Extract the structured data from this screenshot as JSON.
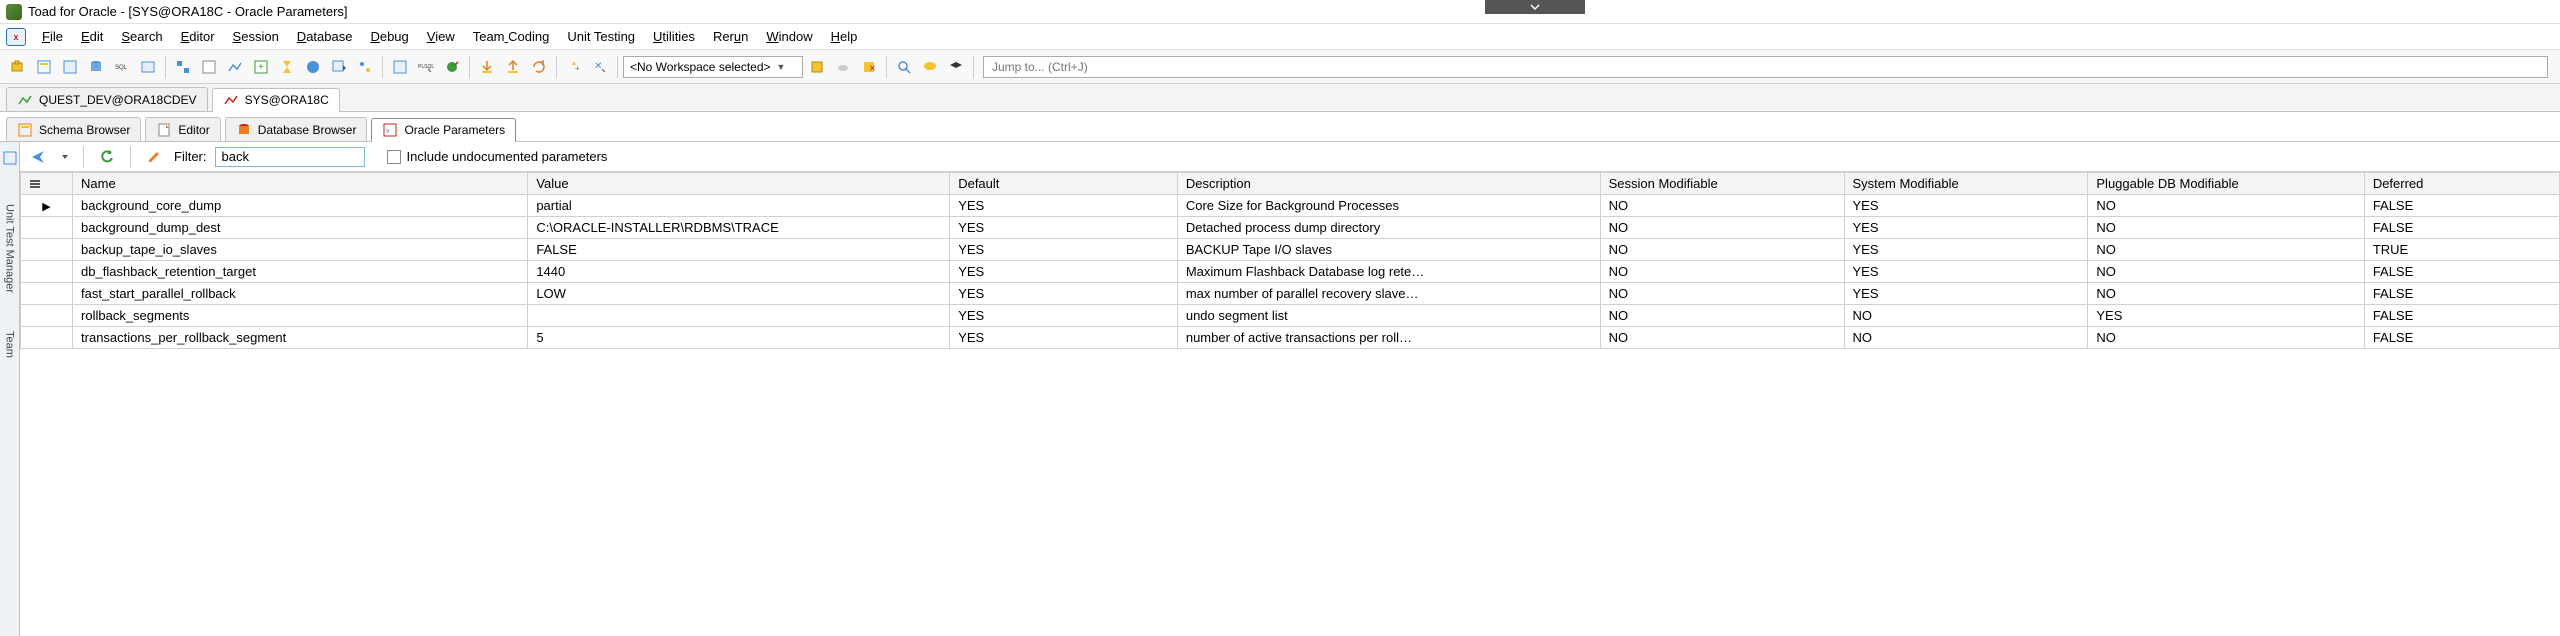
{
  "window_title": "Toad for Oracle - [SYS@ORA18C - Oracle Parameters]",
  "dropdown_handle": "expand",
  "menus": [
    "File",
    "Edit",
    "Search",
    "Editor",
    "Session",
    "Database",
    "Debug",
    "View",
    "Team Coding",
    "Unit Testing",
    "Utilities",
    "Rerun",
    "Window",
    "Help"
  ],
  "menu_accel": [
    0,
    0,
    0,
    0,
    0,
    0,
    0,
    0,
    4,
    null,
    0,
    3,
    0,
    0
  ],
  "workspace_combo": "<No Workspace selected>",
  "jump_placeholder": "Jump to... (Ctrl+J)",
  "conn_tabs": [
    {
      "label": "QUEST_DEV@ORA18CDEV",
      "active": false
    },
    {
      "label": "SYS@ORA18C",
      "active": true
    }
  ],
  "view_tabs": [
    {
      "label": "Schema Browser",
      "active": false
    },
    {
      "label": "Editor",
      "active": false
    },
    {
      "label": "Database Browser",
      "active": false
    },
    {
      "label": "Oracle Parameters",
      "active": true
    }
  ],
  "side_tabs": [
    "Unit Test Manager",
    "Team"
  ],
  "filter": {
    "label": "Filter:",
    "value": "back",
    "undoc_label": "Include undocumented parameters",
    "undoc_checked": false
  },
  "columns": [
    "Name",
    "Value",
    "Default",
    "Description",
    "Session Modifiable",
    "System Modifiable",
    "Pluggable DB Modifiable",
    "Deferred"
  ],
  "rows": [
    {
      "ptr": true,
      "name": "background_core_dump",
      "value": "partial",
      "default": "YES",
      "desc": "Core Size for Background Processes",
      "sess": "NO",
      "sys": "YES",
      "pdb": "NO",
      "def": "FALSE"
    },
    {
      "ptr": false,
      "name": "background_dump_dest",
      "value": "C:\\ORACLE-INSTALLER\\RDBMS\\TRACE",
      "default": "YES",
      "desc": "Detached process dump directory",
      "sess": "NO",
      "sys": "YES",
      "pdb": "NO",
      "def": "FALSE"
    },
    {
      "ptr": false,
      "name": "backup_tape_io_slaves",
      "value": "FALSE",
      "default": "YES",
      "desc": "BACKUP Tape I/O slaves",
      "sess": "NO",
      "sys": "YES",
      "pdb": "NO",
      "def": "TRUE"
    },
    {
      "ptr": false,
      "name": "db_flashback_retention_target",
      "value": "1440",
      "default": "YES",
      "desc": "Maximum Flashback Database log rete…",
      "sess": "NO",
      "sys": "YES",
      "pdb": "NO",
      "def": "FALSE"
    },
    {
      "ptr": false,
      "name": "fast_start_parallel_rollback",
      "value": "LOW",
      "default": "YES",
      "desc": "max number of parallel recovery slave…",
      "sess": "NO",
      "sys": "YES",
      "pdb": "NO",
      "def": "FALSE"
    },
    {
      "ptr": false,
      "name": "rollback_segments",
      "value": "",
      "default": "YES",
      "desc": "undo segment list",
      "sess": "NO",
      "sys": "NO",
      "pdb": "YES",
      "def": "FALSE"
    },
    {
      "ptr": false,
      "name": "transactions_per_rollback_segment",
      "value": "5",
      "default": "YES",
      "desc": "number of active transactions per roll…",
      "sess": "NO",
      "sys": "NO",
      "pdb": "NO",
      "def": "FALSE"
    }
  ]
}
